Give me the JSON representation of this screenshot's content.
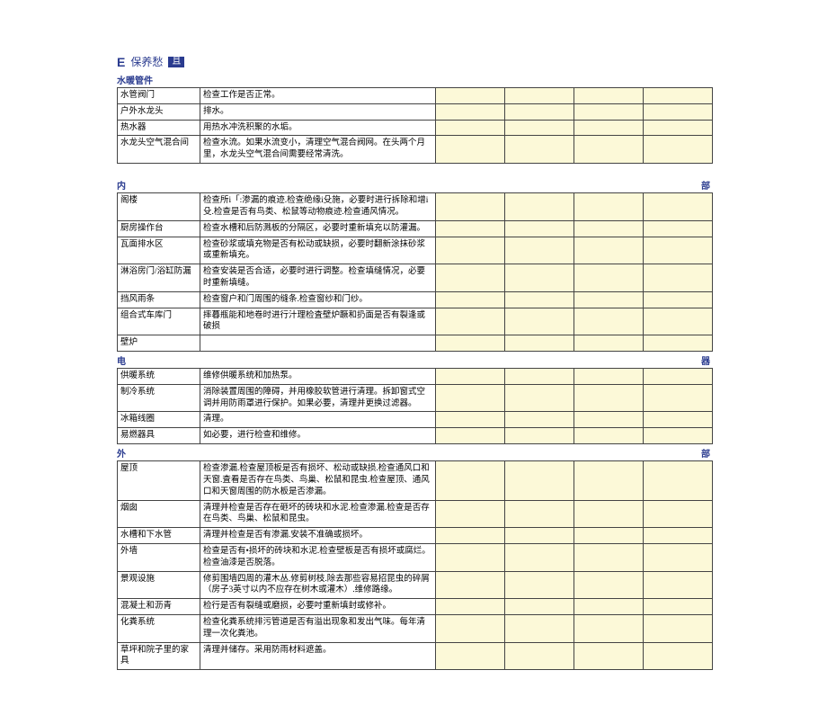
{
  "header": {
    "e": "E",
    "cn": "保养愁",
    "box": "且"
  },
  "sections": [
    {
      "title": "水暖管件",
      "rows": [
        {
          "label": "水管阀门",
          "desc": "检查工作是否正常。"
        },
        {
          "label": "户外水龙头",
          "desc": "排水。"
        },
        {
          "label": "热水器",
          "desc": "用热水冲洗积聚的水垢。"
        },
        {
          "label": "水龙头空气混合间",
          "desc": "检查水流。如果水流变小，清理空气混合阀网。在头两个月里，水龙头空气混合间需要经常清洗。"
        }
      ],
      "gapAfter": true
    },
    {
      "titleSplit": [
        "内",
        "部"
      ],
      "rows": [
        {
          "label": "阁楼",
          "desc": "检查所i「:渗漏的痕迹.检查绝缘i殳施，必要时进行拆除和增i殳.检查是否有鸟类、松鼠等动物痕迹.检查通风情况。"
        },
        {
          "label": "厨房操作台",
          "desc": "检查水槽和后防溅板的分隔区，必要时重新填充以防灌漏。"
        },
        {
          "label": "瓦面排水区",
          "desc": "检查砂浆或填充物是否有松动或缺损，必要时翻新涂抹砂浆或重新填充。"
        },
        {
          "label": "淋浴房门/浴缸防漏",
          "desc": "检查安装是否合适，必要时进行调整。检查填缝情况，必要时重新填缝。"
        },
        {
          "label": "挡风雨条",
          "desc": "检查窗户和门周围的缝条.检查窗纱和门纱。"
        },
        {
          "label": "组合式车库门",
          "desc": "摔暮瓶能和地卷时进行汁理检査壁炉蹶和扔面是否有裂逢或破损"
        },
        {
          "label": "壁炉",
          "desc": ""
        }
      ]
    },
    {
      "titleSplit": [
        "电",
        "器"
      ],
      "rows": [
        {
          "label": "供暖系统",
          "desc": "维修供暖系统和加热泵。"
        },
        {
          "label": "制冷系统",
          "desc": "消除装置周围的障碍，并用橡胶软管进行清理。拆卸窗式空调并用防雨罩进行保护。如果必要，清理并更换过滤器。"
        },
        {
          "label": "冰箱线圈",
          "desc": "清理。"
        },
        {
          "label": "易燃器具",
          "desc": "如必要，进行检查和维修。"
        }
      ]
    },
    {
      "titleSplit": [
        "外",
        "部"
      ],
      "rows": [
        {
          "label": "屋顶",
          "desc": "检查渗漏.检查屋顶板是否有损坏、松动或缺损.检查通风口和天窗.査看是否存在鸟类、鸟巢、松鼠和昆虫.检查屋顶、通风口和天窗周围的防水板是否渗漏。"
        },
        {
          "label": "烟囱",
          "desc": "清理并检查是否存在砸坏的砖块和水泥.检查渗漏.检查是否存在鸟类、鸟巢、松鼠和昆虫。"
        },
        {
          "label": "水槽和下水管",
          "desc": "清理并检查是否有渗漏.安装不准确或损坏。"
        },
        {
          "label": "外墙",
          "desc": "检查是否有•损坏的砖块和水泥.检查壁板是否有损坏或腐烂。检查油漆是否脱落。"
        },
        {
          "label": "景观设施",
          "desc": "修剪围墙四周的灌木丛.修剪树枝.除去那些容易招昆虫的碎屑（房子3英寸以内不应存在树木或灌木）.维修路缘。"
        },
        {
          "label": "混凝土和沥青",
          "desc": "检行是否有裂缝或磨损，必要吋重新填封或修补。"
        },
        {
          "label": "化粪系统",
          "desc": "检查化粪系统排污管道是否有溢出现象和发出气味。每年清理一次化粪池。"
        },
        {
          "label": "草坪和院子里的家具",
          "desc": "清理并储存。采用防雨材料遮盖。"
        }
      ]
    }
  ]
}
